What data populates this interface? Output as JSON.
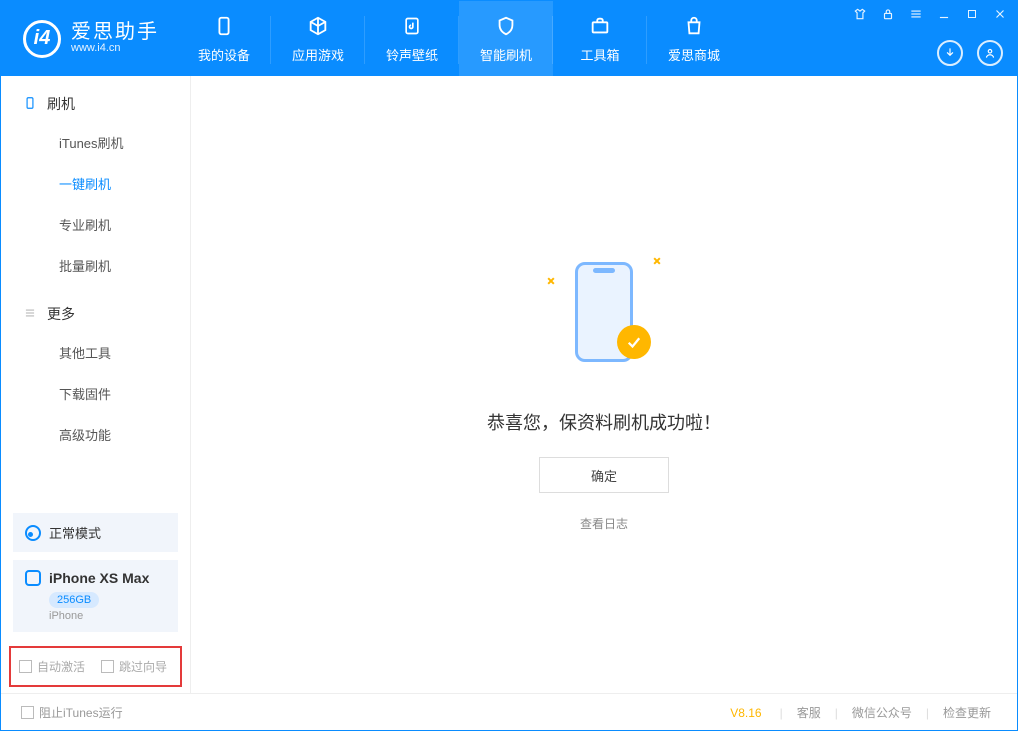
{
  "brand": {
    "name_cn": "爱思助手",
    "name_en": "www.i4.cn"
  },
  "nav": {
    "tabs": [
      {
        "label": "我的设备"
      },
      {
        "label": "应用游戏"
      },
      {
        "label": "铃声壁纸"
      },
      {
        "label": "智能刷机"
      },
      {
        "label": "工具箱"
      },
      {
        "label": "爱思商城"
      }
    ]
  },
  "sidebar": {
    "section1": {
      "title": "刷机",
      "items": [
        "iTunes刷机",
        "一键刷机",
        "专业刷机",
        "批量刷机"
      ]
    },
    "section2": {
      "title": "更多",
      "items": [
        "其他工具",
        "下载固件",
        "高级功能"
      ]
    },
    "mode": "正常模式",
    "device": {
      "name": "iPhone XS Max",
      "capacity": "256GB",
      "type": "iPhone"
    },
    "opts": {
      "auto_activate": "自动激活",
      "skip_guide": "跳过向导"
    }
  },
  "main": {
    "message": "恭喜您，保资料刷机成功啦！",
    "ok": "确定",
    "view_log": "查看日志"
  },
  "footer": {
    "block_itunes": "阻止iTunes运行",
    "version": "V8.16",
    "links": [
      "客服",
      "微信公众号",
      "检查更新"
    ]
  }
}
